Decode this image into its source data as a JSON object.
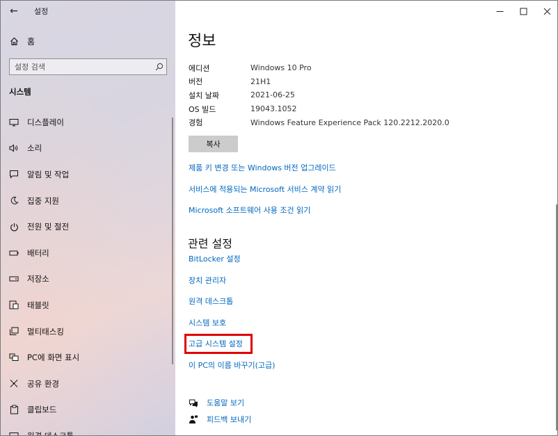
{
  "app": {
    "title": "설정",
    "back_glyph": "←"
  },
  "window_controls": {
    "minimize": "—",
    "maximize": "☐",
    "close": "✕"
  },
  "sidebar": {
    "home_label": "홈",
    "search_placeholder": "설정 검색",
    "section_title": "시스템",
    "items": [
      {
        "label": "디스플레이",
        "icon": "display-icon"
      },
      {
        "label": "소리",
        "icon": "sound-icon"
      },
      {
        "label": "알림 및 작업",
        "icon": "notification-icon"
      },
      {
        "label": "집중 지원",
        "icon": "moon-icon"
      },
      {
        "label": "전원 및 절전",
        "icon": "power-icon"
      },
      {
        "label": "배터리",
        "icon": "battery-icon"
      },
      {
        "label": "저장소",
        "icon": "storage-icon"
      },
      {
        "label": "태블릿",
        "icon": "tablet-icon"
      },
      {
        "label": "멀티태스킹",
        "icon": "multitasking-icon"
      },
      {
        "label": "PC에 화면 표시",
        "icon": "project-icon"
      },
      {
        "label": "공유 환경",
        "icon": "shared-icon"
      },
      {
        "label": "클립보드",
        "icon": "clipboard-icon"
      },
      {
        "label": "원격 데스크톱",
        "icon": "remote-desktop-icon"
      }
    ]
  },
  "main": {
    "title": "정보",
    "specs": [
      {
        "key": "에디션",
        "value": "Windows 10 Pro"
      },
      {
        "key": "버전",
        "value": "21H1"
      },
      {
        "key": "설치 날짜",
        "value": "2021-06-25"
      },
      {
        "key": "OS 빌드",
        "value": "19043.1052"
      },
      {
        "key": "경험",
        "value": "Windows Feature Experience Pack 120.2212.2020.0"
      }
    ],
    "copy_label": "복사",
    "links": [
      "제품 키 변경 또는 Windows 버전 업그레이드",
      "서비스에 적용되는 Microsoft 서비스 계약 읽기",
      "Microsoft 소프트웨어 사용 조건 읽기"
    ],
    "related_title": "관련 설정",
    "related_links": [
      "BitLocker 설정",
      "장치 관리자",
      "원격 데스크톱",
      "시스템 보호",
      "고급 시스템 설정",
      "이 PC의 이름 바꾸기(고급)"
    ],
    "help": [
      {
        "label": "도움말 보기",
        "icon": "help-icon"
      },
      {
        "label": "피드백 보내기",
        "icon": "feedback-icon"
      }
    ]
  },
  "colors": {
    "link": "#0067c0",
    "highlight": "#e00000"
  }
}
